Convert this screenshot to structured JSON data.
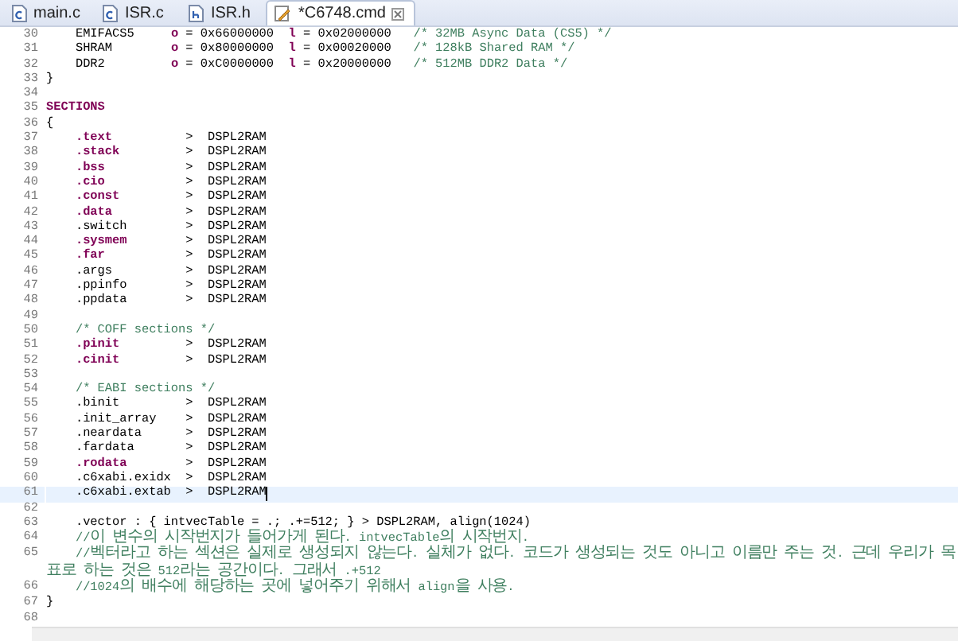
{
  "tabs": [
    {
      "label": "main.c",
      "kind": "c",
      "selected": false
    },
    {
      "label": "ISR.c",
      "kind": "c",
      "selected": false
    },
    {
      "label": "ISR.h",
      "kind": "h",
      "selected": false
    },
    {
      "label": "*C6748.cmd",
      "kind": "cmd",
      "selected": true
    }
  ],
  "lines": [
    {
      "number": "30",
      "current": false,
      "tokens": [
        {
          "text": "    EMIFACS5     ",
          "kind": "plain"
        },
        {
          "text": "o",
          "kind": "keyword"
        },
        {
          "text": " = 0x66000000  ",
          "kind": "plain"
        },
        {
          "text": "l",
          "kind": "keyword"
        },
        {
          "text": " = 0x02000000   ",
          "kind": "plain"
        },
        {
          "text": "/* 32MB Async Data (CS5) */",
          "kind": "comment"
        }
      ]
    },
    {
      "number": "31",
      "current": false,
      "tokens": [
        {
          "text": "    SHRAM        ",
          "kind": "plain"
        },
        {
          "text": "o",
          "kind": "keyword"
        },
        {
          "text": " = 0x80000000  ",
          "kind": "plain"
        },
        {
          "text": "l",
          "kind": "keyword"
        },
        {
          "text": " = 0x00020000   ",
          "kind": "plain"
        },
        {
          "text": "/* 128kB Shared RAM */",
          "kind": "comment"
        }
      ]
    },
    {
      "number": "32",
      "current": false,
      "tokens": [
        {
          "text": "    DDR2         ",
          "kind": "plain"
        },
        {
          "text": "o",
          "kind": "keyword"
        },
        {
          "text": " = 0xC0000000  ",
          "kind": "plain"
        },
        {
          "text": "l",
          "kind": "keyword"
        },
        {
          "text": " = 0x20000000   ",
          "kind": "plain"
        },
        {
          "text": "/* 512MB DDR2 Data */",
          "kind": "comment"
        }
      ]
    },
    {
      "number": "33",
      "current": false,
      "tokens": [
        {
          "text": "}",
          "kind": "plain"
        }
      ]
    },
    {
      "number": "34",
      "current": false
    },
    {
      "number": "35",
      "current": false,
      "tokens": [
        {
          "text": "SECTIONS",
          "kind": "keyword"
        }
      ]
    },
    {
      "number": "36",
      "current": false,
      "tokens": [
        {
          "text": "{",
          "kind": "plain"
        }
      ]
    },
    {
      "number": "37",
      "current": false,
      "tokens": [
        {
          "text": "    .text",
          "kind": "keyword"
        },
        {
          "text": "          >  DSPL2RAM",
          "kind": "plain"
        }
      ]
    },
    {
      "number": "38",
      "current": false,
      "tokens": [
        {
          "text": "    .stack",
          "kind": "keyword"
        },
        {
          "text": "         >  DSPL2RAM",
          "kind": "plain"
        }
      ]
    },
    {
      "number": "39",
      "current": false,
      "tokens": [
        {
          "text": "    .bss",
          "kind": "keyword"
        },
        {
          "text": "           >  DSPL2RAM",
          "kind": "plain"
        }
      ]
    },
    {
      "number": "40",
      "current": false,
      "tokens": [
        {
          "text": "    .cio",
          "kind": "keyword"
        },
        {
          "text": "           >  DSPL2RAM",
          "kind": "plain"
        }
      ]
    },
    {
      "number": "41",
      "current": false,
      "tokens": [
        {
          "text": "    .const",
          "kind": "keyword"
        },
        {
          "text": "         >  DSPL2RAM",
          "kind": "plain"
        }
      ]
    },
    {
      "number": "42",
      "current": false,
      "tokens": [
        {
          "text": "    .data",
          "kind": "keyword"
        },
        {
          "text": "          >  DSPL2RAM",
          "kind": "plain"
        }
      ]
    },
    {
      "number": "43",
      "current": false,
      "tokens": [
        {
          "text": "    .switch        >  DSPL2RAM",
          "kind": "plain"
        }
      ]
    },
    {
      "number": "44",
      "current": false,
      "tokens": [
        {
          "text": "    .sysmem",
          "kind": "keyword"
        },
        {
          "text": "        >  DSPL2RAM",
          "kind": "plain"
        }
      ]
    },
    {
      "number": "45",
      "current": false,
      "tokens": [
        {
          "text": "    .far",
          "kind": "keyword"
        },
        {
          "text": "           >  DSPL2RAM",
          "kind": "plain"
        }
      ]
    },
    {
      "number": "46",
      "current": false,
      "tokens": [
        {
          "text": "    .args          >  DSPL2RAM",
          "kind": "plain"
        }
      ]
    },
    {
      "number": "47",
      "current": false,
      "tokens": [
        {
          "text": "    .ppinfo        >  DSPL2RAM",
          "kind": "plain"
        }
      ]
    },
    {
      "number": "48",
      "current": false,
      "tokens": [
        {
          "text": "    .ppdata        >  DSPL2RAM",
          "kind": "plain"
        }
      ]
    },
    {
      "number": "49",
      "current": false
    },
    {
      "number": "50",
      "current": false,
      "tokens": [
        {
          "text": "    /* COFF sections */",
          "kind": "comment"
        }
      ]
    },
    {
      "number": "51",
      "current": false,
      "tokens": [
        {
          "text": "    .pinit",
          "kind": "keyword"
        },
        {
          "text": "         >  DSPL2RAM",
          "kind": "plain"
        }
      ]
    },
    {
      "number": "52",
      "current": false,
      "tokens": [
        {
          "text": "    .cinit",
          "kind": "keyword"
        },
        {
          "text": "         >  DSPL2RAM",
          "kind": "plain"
        }
      ]
    },
    {
      "number": "53",
      "current": false
    },
    {
      "number": "54",
      "current": false,
      "tokens": [
        {
          "text": "    /* EABI sections */",
          "kind": "comment"
        }
      ]
    },
    {
      "number": "55",
      "current": false,
      "tokens": [
        {
          "text": "    .binit         >  DSPL2RAM",
          "kind": "plain"
        }
      ]
    },
    {
      "number": "56",
      "current": false,
      "tokens": [
        {
          "text": "    .init_array    >  DSPL2RAM",
          "kind": "plain"
        }
      ]
    },
    {
      "number": "57",
      "current": false,
      "tokens": [
        {
          "text": "    .neardata      >  DSPL2RAM",
          "kind": "plain"
        }
      ]
    },
    {
      "number": "58",
      "current": false,
      "tokens": [
        {
          "text": "    .fardata       >  DSPL2RAM",
          "kind": "plain"
        }
      ]
    },
    {
      "number": "59",
      "current": false,
      "tokens": [
        {
          "text": "    .rodata",
          "kind": "keyword"
        },
        {
          "text": "        >  DSPL2RAM",
          "kind": "plain"
        }
      ]
    },
    {
      "number": "60",
      "current": false,
      "tokens": [
        {
          "text": "    .c6xabi.exidx  >  DSPL2RAM",
          "kind": "plain"
        }
      ]
    },
    {
      "number": "61",
      "current": true,
      "tokens": [
        {
          "text": "    .c6xabi.extab  >  DSPL2RAM",
          "kind": "plain"
        }
      ]
    },
    {
      "number": "62",
      "current": false
    },
    {
      "number": "63",
      "current": false,
      "tokens": [
        {
          "text": "    .vector : { intvecTable = .; .+=512; } > DSPL2RAM, align(1024)",
          "kind": "plain"
        }
      ]
    },
    {
      "number": "64",
      "current": false,
      "tokens": [
        {
          "text": "    //이 변수의 시작번지가 들어가게 된다. intvecTable의 시작번지.",
          "kind": "comment"
        }
      ]
    },
    {
      "number": "65",
      "current": false,
      "tokens": [
        {
          "text": "    //벡터라고 하는 섹션은 실제로 생성되지 않는다. 실체가 없다. 코드가 생성되는 것도 아니고 이름만 주는 것. 근데 우리가 목표로 하는 것은 512라는 공간이다. 그래서 .+512",
          "kind": "comment"
        }
      ]
    },
    {
      "number": "66",
      "current": false,
      "tokens": [
        {
          "text": "    //1024의 배수에 해당하는 곳에 넣어주기 위해서 align을 사용.",
          "kind": "comment"
        }
      ]
    },
    {
      "number": "67",
      "current": false,
      "tokens": [
        {
          "text": "}",
          "kind": "plain"
        }
      ]
    },
    {
      "number": "68",
      "current": false
    }
  ]
}
